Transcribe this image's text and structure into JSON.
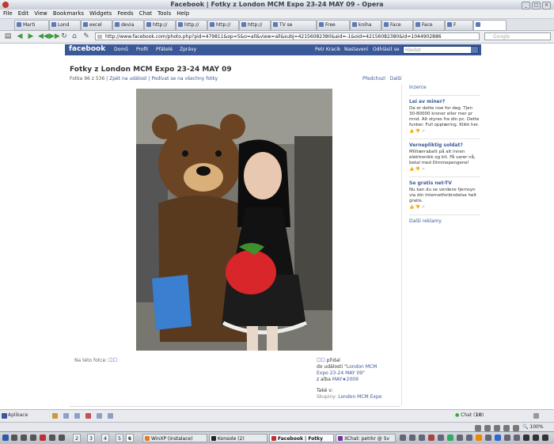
{
  "window": {
    "title": "Facebook | Fotky z London MCM Expo 23-24 MAY 09 - Opera"
  },
  "menu": [
    "File",
    "Edit",
    "View",
    "Bookmarks",
    "Widgets",
    "Feeds",
    "Chat",
    "Tools",
    "Help"
  ],
  "tabs": [
    "Marti",
    "Lond",
    "excel",
    "devia",
    "http://",
    "http://",
    "http://",
    "http://",
    "TV se",
    "Free",
    "kniha",
    "Face",
    "Face",
    "F"
  ],
  "address": {
    "url": "http://www.facebook.com/photo.php?pid=479811&op=5&o=all&view=all&subj=42156082380&aid=-1&oid=42156082380&id=1044902886",
    "search_placeholder": "Google"
  },
  "fb": {
    "logo": "facebook",
    "nav": [
      "Domů",
      "Profil",
      "Přátelé",
      "Zprávy"
    ],
    "right_nav": [
      "Petr Kracik",
      "Nastavení",
      "Odhlásit se"
    ],
    "search_placeholder": "Hledat"
  },
  "page": {
    "title": "Fotky z London MCM Expo 23-24 MAY 09",
    "counter": "Fotka 96 z 536",
    "back_link": "Zpět na událost",
    "all_link": "Podívat se na všechny fotky",
    "prev": "Předchozí",
    "next": "Další",
    "in_photo_label": "Na této fotce:",
    "added_by_suffix": "přidal",
    "to_event": "do události",
    "event_name": "London MCM Expo 23-24 MAY 09",
    "album_prefix": "z alba",
    "album_name": "MAY★2009",
    "also_label": "Také v:",
    "groups_label": "Skupiny:",
    "group_name": "London MCM Expo"
  },
  "sidebar": {
    "header": "Inzerce",
    "ads": [
      {
        "title": "Lei av miner?",
        "text": "Da er dette noe for deg. Tjen 30-80000 kroner eller mer pr mnd. Alt styres fra din pc. Dette funker. Full opplæring. Klikk her."
      },
      {
        "title": "Vernepliktig soldat?",
        "text": "Militærrabatt på alt innen elektronikk og kit. Få varer nå, betal med Dimmepengene!"
      },
      {
        "title": "Se gratis net-TV",
        "text": "Nu kan du se verdens fjernsyn via din Internetforbindelse helt gratis."
      }
    ],
    "more": "Další reklamy"
  },
  "chatbar": {
    "apps": "Aplikace",
    "chat_label": "Chat",
    "chat_count": "10"
  },
  "statusbar": {
    "zoom": "100%"
  },
  "taskbar": {
    "workspaces": [
      "2",
      "3",
      "4",
      "5",
      "6"
    ],
    "active_workspace": "6",
    "tasks": [
      "WinXP (instalace)",
      "Konsole (2)",
      "Facebook | Fotky",
      "XChat: petrkr @ Sv"
    ]
  },
  "colors": {
    "facebook_blue": "#3b5998",
    "link": "#3b5998"
  }
}
